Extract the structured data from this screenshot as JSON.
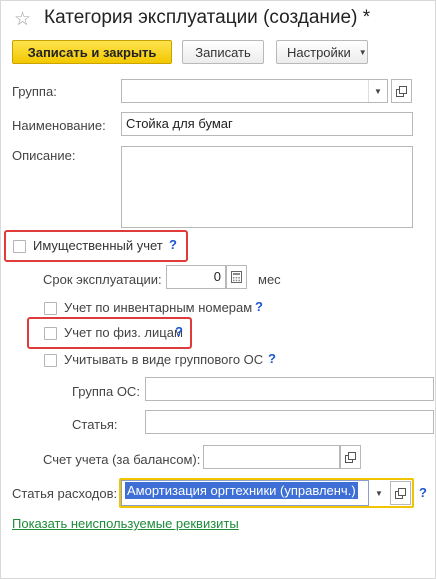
{
  "window": {
    "title": "Категория эксплуатации (создание) *"
  },
  "toolbar": {
    "save_close_label": "Записать и закрыть",
    "save_label": "Записать",
    "settings_label": "Настройки"
  },
  "form": {
    "group_label": "Группа:",
    "group_value": "",
    "name_label": "Наименование:",
    "name_value": "Стойка для бумаг",
    "description_label": "Описание:",
    "description_value": "",
    "property_accounting_label": "Имущественный учет",
    "property_accounting_checked": false,
    "service_life_label": "Срок эксплуатации:",
    "service_life_value": "0",
    "service_life_unit": "мес",
    "inventory_numbers_label": "Учет по инвентарным номерам",
    "inventory_numbers_checked": false,
    "individuals_label": "Учет по физ. лицам",
    "individuals_checked": false,
    "group_os_label": "Учитывать в виде группового ОС",
    "group_os_checked": false,
    "os_group_label": "Группа ОС:",
    "os_group_value": "",
    "article_label": "Статья:",
    "article_value": "",
    "account_label": "Счет учета (за балансом):",
    "account_value": "",
    "expense_article_label": "Статья расходов:",
    "expense_article_value": "Амортизация оргтехники (управленч.)",
    "help_mark": "?",
    "show_unused_link": "Показать неиспользуемые реквизиты"
  },
  "colors": {
    "primary_button": "#f5cc0a",
    "highlight_box": "#e03b3b",
    "focus_border": "#f0c400",
    "selection": "#3d6fd6",
    "help": "#1c56d4",
    "link": "#1f8a3a"
  }
}
